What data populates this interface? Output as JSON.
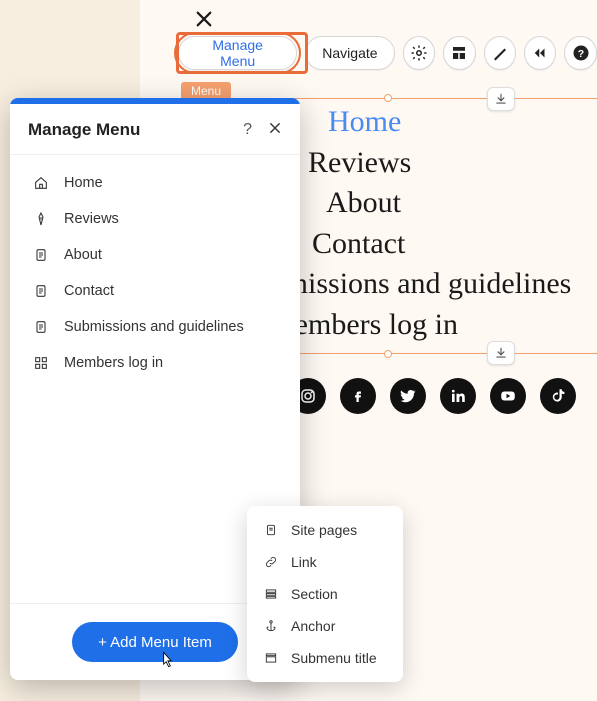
{
  "toolbar": {
    "manage_label": "Manage Menu",
    "navigate_label": "Navigate"
  },
  "selection_tag": "Menu",
  "nav": {
    "items": [
      {
        "label": "Home",
        "active": true
      },
      {
        "label": "Reviews",
        "active": false
      },
      {
        "label": "About",
        "active": false
      },
      {
        "label": "Contact",
        "active": false
      },
      {
        "label": "Submissions and guidelines",
        "active": false
      },
      {
        "label": "Members log in",
        "active": false
      }
    ]
  },
  "socials": [
    "instagram",
    "facebook",
    "twitter",
    "linkedin",
    "youtube",
    "tiktok"
  ],
  "panel": {
    "title": "Manage Menu",
    "items": [
      {
        "icon": "home",
        "label": "Home"
      },
      {
        "icon": "pen",
        "label": "Reviews"
      },
      {
        "icon": "page",
        "label": "About"
      },
      {
        "icon": "page",
        "label": "Contact"
      },
      {
        "icon": "page",
        "label": "Submissions and guidelines"
      },
      {
        "icon": "grid",
        "label": "Members log in"
      }
    ],
    "add_label": "+ Add Menu Item"
  },
  "dropdown": {
    "items": [
      {
        "icon": "page",
        "label": "Site pages"
      },
      {
        "icon": "link",
        "label": "Link"
      },
      {
        "icon": "section",
        "label": "Section"
      },
      {
        "icon": "anchor",
        "label": "Anchor"
      },
      {
        "icon": "submenu",
        "label": "Submenu title"
      }
    ]
  }
}
